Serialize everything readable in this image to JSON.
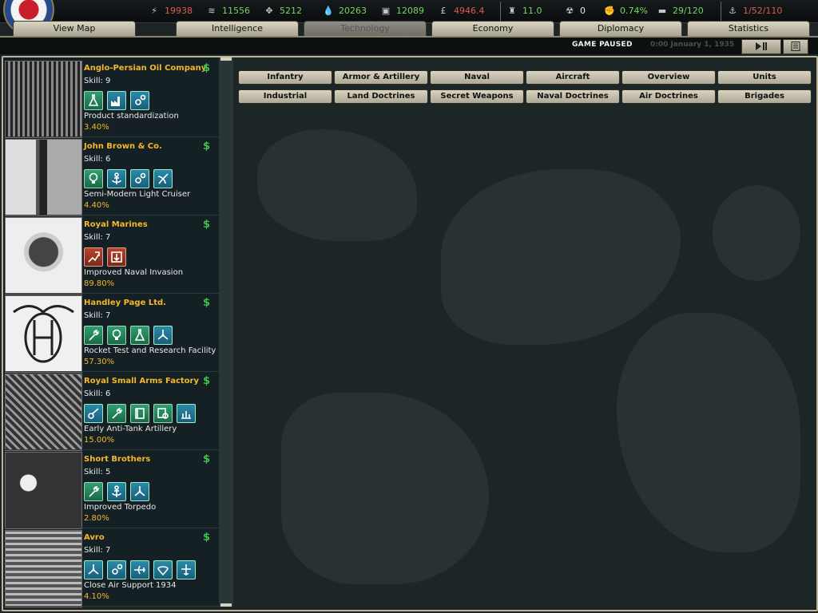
{
  "resources": [
    {
      "icon": "energy-icon",
      "value": "19938",
      "color": "red"
    },
    {
      "icon": "metal-icon",
      "value": "11556",
      "color": "green"
    },
    {
      "icon": "rare-materials-icon",
      "value": "5212",
      "color": "green"
    },
    {
      "icon": "oil-icon",
      "value": "20263",
      "color": "green"
    },
    {
      "icon": "supplies-icon",
      "value": "12089",
      "color": "green"
    },
    {
      "icon": "money-icon",
      "value": "4946.4",
      "color": "red"
    },
    {
      "icon": "manpower-icon",
      "value": "11.0",
      "color": "green"
    },
    {
      "icon": "nuclear-icon",
      "value": "0",
      "color": "white"
    },
    {
      "icon": "dissent-icon",
      "value": "0.74%",
      "color": "green"
    },
    {
      "icon": "transports-icon",
      "value": "29/120",
      "color": "green"
    },
    {
      "icon": "convoys-icon",
      "value": "1/52/110",
      "color": "red"
    }
  ],
  "nav": [
    {
      "label": "View Map",
      "active": false
    },
    {
      "label": "Intelligence",
      "active": false
    },
    {
      "label": "Technology",
      "active": true
    },
    {
      "label": "Economy",
      "active": false
    },
    {
      "label": "Diplomacy",
      "active": false
    },
    {
      "label": "Statistics",
      "active": false
    }
  ],
  "status": {
    "paused": "GAME PAUSED",
    "datetime": "0:00 January 1, 1935"
  },
  "teams": [
    {
      "name": "Anglo-Persian Oil Company",
      "skill": "Skill: 9",
      "project": "Product standardization",
      "percent": "3.40%",
      "icons": [
        "flask-icon",
        "factory-icon",
        "gears-icon"
      ],
      "icon_colors": [
        "g",
        "b",
        "b"
      ]
    },
    {
      "name": "John Brown & Co.",
      "skill": "Skill: 6",
      "project": "Semi-Modern Light Cruiser",
      "percent": "4.40%",
      "icons": [
        "lightbulb-icon",
        "anchor-icon",
        "gears-icon",
        "radar-icon"
      ],
      "icon_colors": [
        "g",
        "b",
        "b",
        "b"
      ]
    },
    {
      "name": "Royal Marines",
      "skill": "Skill: 7",
      "project": "Improved Naval Invasion",
      "percent": "89.80%",
      "icons": [
        "tactics-icon",
        "naval-landing-icon"
      ],
      "icon_colors": [
        "r",
        "r"
      ]
    },
    {
      "name": "Handley Page Ltd.",
      "skill": "Skill: 7",
      "project": "Rocket Test and Research Facility",
      "percent": "57.30%",
      "icons": [
        "wrench-icon",
        "lightbulb-icon",
        "flask-icon",
        "propeller-icon"
      ],
      "icon_colors": [
        "g",
        "g",
        "g",
        "b"
      ]
    },
    {
      "name": "Royal Small Arms Factory",
      "skill": "Skill: 6",
      "project": "Early Anti-Tank Artillery",
      "percent": "15.00%",
      "icons": [
        "artillery-icon",
        "wrench-icon",
        "book-icon",
        "blueprint-icon",
        "infantry-icon"
      ],
      "icon_colors": [
        "b",
        "g",
        "g",
        "g",
        "b"
      ]
    },
    {
      "name": "Short Brothers",
      "skill": "Skill: 5",
      "project": "Improved Torpedo",
      "percent": "2.80%",
      "icons": [
        "wrench-icon",
        "anchor-icon",
        "propeller-icon"
      ],
      "icon_colors": [
        "g",
        "b",
        "b"
      ]
    },
    {
      "name": "Avro",
      "skill": "Skill: 7",
      "project": "Close Air Support 1934",
      "percent": "4.10%",
      "icons": [
        "propeller-icon",
        "gears-icon",
        "plane-icon",
        "parachute-icon",
        "fighter-icon"
      ],
      "icon_colors": [
        "b",
        "b",
        "b",
        "b",
        "b"
      ]
    }
  ],
  "tech_tabs_row1": [
    "Infantry",
    "Armor & Artillery",
    "Naval",
    "Aircraft",
    "Overview",
    "Units"
  ],
  "tech_tabs_row2": [
    "Industrial",
    "Land Doctrines",
    "Secret Weapons",
    "Naval Doctrines",
    "Air Doctrines",
    "Brigades"
  ]
}
